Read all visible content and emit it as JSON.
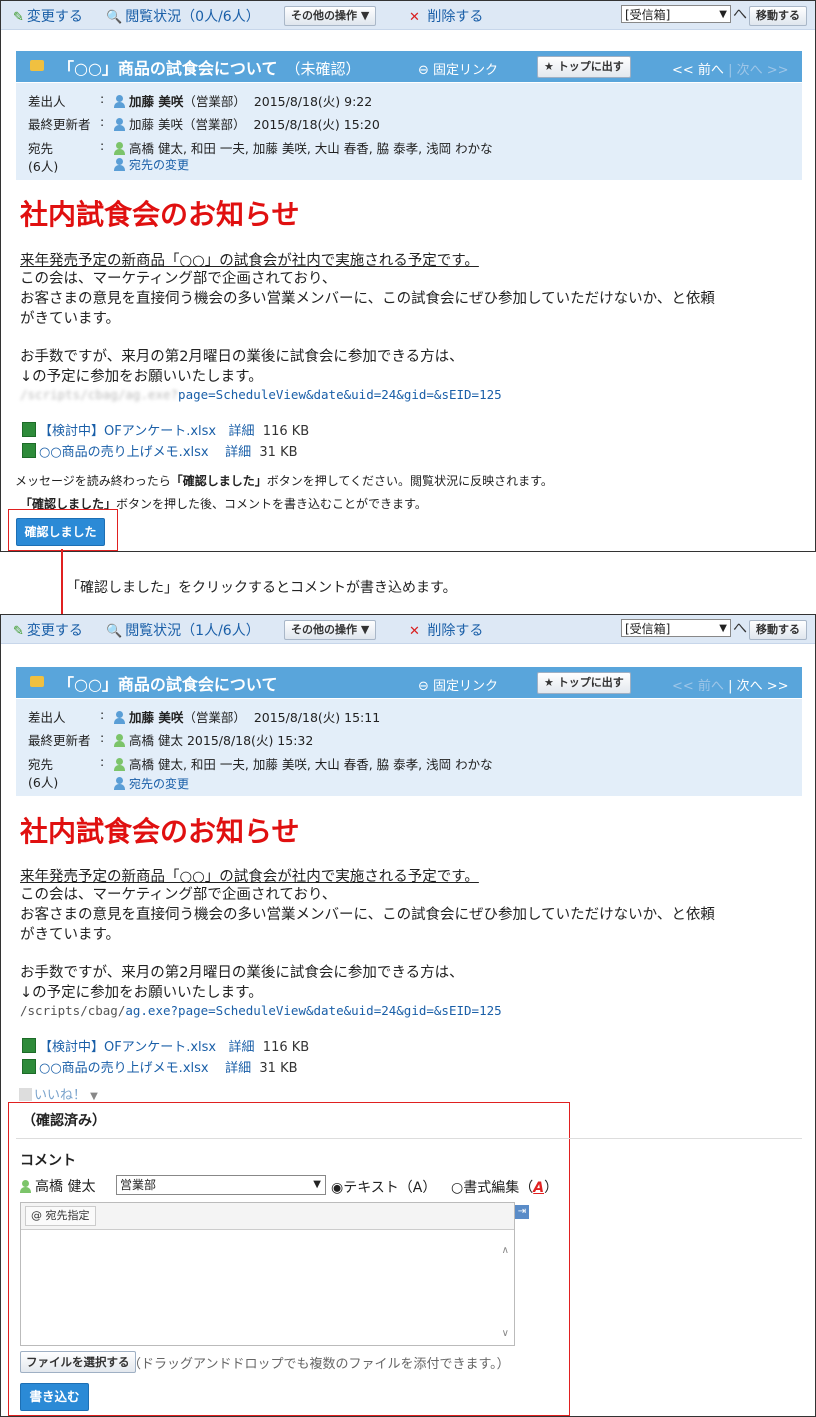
{
  "panels": [
    {
      "toolbar": {
        "edit": "変更する",
        "read_status": "閲覧状況（0人/6人）",
        "other_ops": "その他の操作",
        "delete": "削除する",
        "folder": "[受信箱]",
        "move": "移動する"
      },
      "title": "「○○」商品の試食会について",
      "title_status": "（未確認）",
      "permalink": "固定リンク",
      "top_button": "トップに出す",
      "nav_prev": "<< 前へ",
      "nav_sep": "|",
      "nav_next": "次へ >>",
      "meta": {
        "sender_label": "差出人",
        "sender_name": "加藤 美咲",
        "sender_dept": "（営業部）",
        "sent_at": "2015/8/18(火) 9:22",
        "updater_label": "最終更新者",
        "updater_name": "加藤 美咲",
        "updater_dept": "（営業部）",
        "updated_at": "2015/8/18(火) 15:20",
        "to_label": "宛先",
        "to_count": "(6人)",
        "recipients": "高橋 健太, 和田 一夫, 加藤 美咲, 大山 春香, 脇 泰孝, 浅岡 わかな",
        "change_recipients": "宛先の変更"
      },
      "headline": "社内試食会のお知らせ",
      "body": [
        "来年発売予定の新商品「○○」の試食会が社内で実施される予定です。",
        "この会は、マーケティング部で企画されており、",
        "お客さまの意見を直接伺う機会の多い営業メンバーに、この試食会にぜひ参加していただけないか、と依頼",
        "がきています。",
        "お手数ですが、来月の第2月曜日の業後に試食会に参加できる方は、",
        "↓の予定に参加をお願いいたします。"
      ],
      "url_blurred": "/scripts/cbag/ag.exe?",
      "url_link": "page=ScheduleView&date&uid=24&gid=&sEID=125",
      "files": [
        {
          "name": "【検討中】OFアンケート.xlsx",
          "detail": "詳細",
          "size": "116 KB"
        },
        {
          "name": "○○商品の売り上げメモ.xlsx",
          "detail": "詳細",
          "size": "31 KB"
        }
      ],
      "note1_pre": "メッセージを読み終わったら",
      "note1_bold": "「確認しました」",
      "note1_post": "ボタンを押してください。閲覧状況に反映されます。",
      "note2_bold": "「確認しました」",
      "note2_post": "ボタンを押した後、コメントを書き込むことができます。",
      "confirm_button": "確認しました"
    },
    {
      "toolbar": {
        "edit": "変更する",
        "read_status": "閲覧状況（1人/6人）",
        "other_ops": "その他の操作",
        "delete": "削除する",
        "folder": "[受信箱]",
        "move": "移動する"
      },
      "title": "「○○」商品の試食会について",
      "permalink": "固定リンク",
      "top_button": "トップに出す",
      "nav_prev": "<< 前へ",
      "nav_sep": "|",
      "nav_next": "次へ >>",
      "meta": {
        "sender_label": "差出人",
        "sender_name": "加藤 美咲",
        "sender_dept": "（営業部）",
        "sent_at": "2015/8/18(火) 15:11",
        "updater_label": "最終更新者",
        "updater_name": "高橋 健太",
        "updated_at": "2015/8/18(火) 15:32",
        "to_label": "宛先",
        "to_count": "(6人)",
        "recipients": "高橋 健太, 和田 一夫, 加藤 美咲, 大山 春香, 脇 泰孝, 浅岡 わかな",
        "change_recipients": "宛先の変更"
      },
      "headline": "社内試食会のお知らせ",
      "body": [
        "来年発売予定の新商品「○○」の試食会が社内で実施される予定です。",
        "この会は、マーケティング部で企画されており、",
        "お客さまの意見を直接伺う機会の多い営業メンバーに、この試食会にぜひ参加していただけないか、と依頼",
        "がきています。",
        "お手数ですが、来月の第2月曜日の業後に試食会に参加できる方は、",
        "↓の予定に参加をお願いいたします。"
      ],
      "url_prefix": "/scripts/cbag/",
      "url_link": "ag.exe?page=ScheduleView&date&uid=24&gid=&sEID=125",
      "files": [
        {
          "name": "【検討中】OFアンケート.xlsx",
          "detail": "詳細",
          "size": "116 KB"
        },
        {
          "name": "○○商品の売り上げメモ.xlsx",
          "detail": "詳細",
          "size": "31 KB"
        }
      ],
      "like": "いいね！",
      "confirmed": "（確認済み）",
      "comment_label": "コメント",
      "commenter": "高橋 健太",
      "dept_select": "営業部",
      "radio_text": "テキスト（A）",
      "radio_rich": "書式編集（",
      "radio_rich_a": "A",
      "radio_rich_close": "）",
      "at_button": "@ 宛先指定",
      "file_button": "ファイルを選択する",
      "dnd_note": "（ドラッグアンドドロップでも複数のファイルを添付できます。）",
      "write_button": "書き込む"
    }
  ],
  "caption": "「確認しました」をクリックするとコメントが書き込めます。",
  "colors": {
    "accent": "#59a5db",
    "highlight": "#e02020",
    "button": "#2b8ad6"
  }
}
